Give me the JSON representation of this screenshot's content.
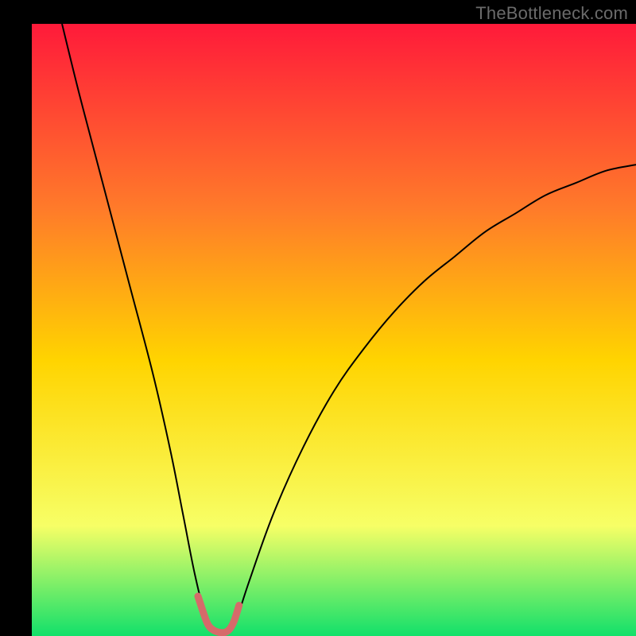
{
  "watermark": "TheBottleneck.com",
  "chart_data": {
    "type": "line",
    "title": "",
    "xlabel": "",
    "ylabel": "",
    "xlim": [
      0,
      100
    ],
    "ylim": [
      0,
      100
    ],
    "grid": false,
    "legend": false,
    "background_gradient": {
      "top": "#ff1a3a",
      "upper_mid": "#ff7a2a",
      "mid": "#ffd400",
      "lower_mid": "#f7ff66",
      "bottom": "#12e06a"
    },
    "series": [
      {
        "name": "bottleneck-curve",
        "stroke": "#000000",
        "stroke_width": 2,
        "x": [
          5,
          8,
          12,
          16,
          20,
          23,
          25,
          27,
          28.8,
          30,
          31,
          32,
          33,
          34,
          36,
          40,
          45,
          50,
          55,
          60,
          65,
          70,
          75,
          80,
          85,
          90,
          95,
          100
        ],
        "y": [
          100,
          88,
          73,
          58,
          43,
          30,
          20,
          10,
          3,
          1,
          0.5,
          0.5,
          1,
          3,
          9,
          20,
          31,
          40,
          47,
          53,
          58,
          62,
          66,
          69,
          72,
          74,
          76,
          77
        ]
      },
      {
        "name": "valley-highlight",
        "stroke": "#d66a6a",
        "stroke_width": 9,
        "x": [
          27.5,
          28.5,
          29.2,
          30,
          31,
          32,
          32.8,
          33.5,
          34.3
        ],
        "y": [
          6.5,
          3.5,
          1.8,
          1,
          0.6,
          0.6,
          1.2,
          2.5,
          5
        ]
      }
    ]
  }
}
